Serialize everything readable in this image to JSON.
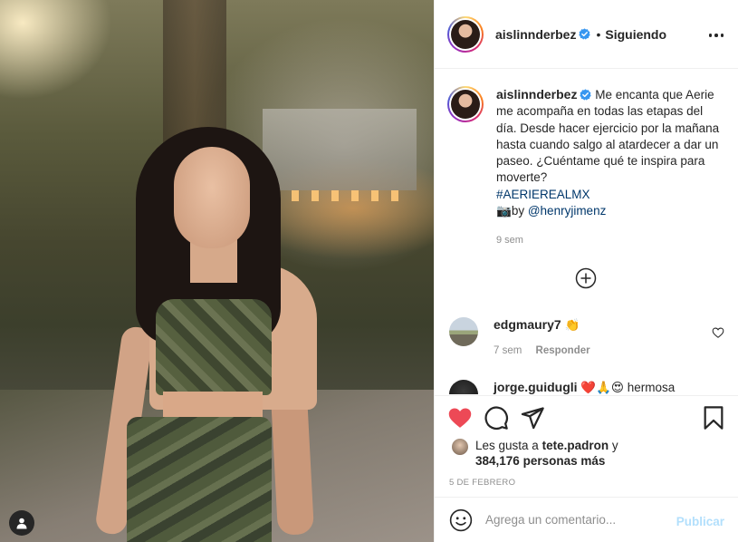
{
  "post": {
    "author": "aislinnderbez",
    "follow_status": "Siguiendo",
    "separator": "•",
    "caption": {
      "text": "Me encanta que Aerie me acompaña en todas las etapas del día. Desde hacer ejercicio por la mañana hasta cuando salgo al atardecer a dar un paseo. ¿Cuéntame qué te inspira para moverte?",
      "hashtag": "#AERIEREALMX",
      "credit_emoji": "📷",
      "credit_prefix": "by",
      "credit_mention": "@henryjimenz",
      "age": "9 sem"
    },
    "load_more_icon": "plus-circle-icon"
  },
  "comments": [
    {
      "user": "edgmaury7",
      "text": "👏",
      "age": "7 sem",
      "reply_label": "Responder"
    },
    {
      "user": "jorge.guidugli",
      "text": "❤️🙏😍 hermosa",
      "age": "",
      "reply_label": ""
    }
  ],
  "likes": {
    "prefix": "Les gusta a",
    "user": "tete.padron",
    "conjunction": "y",
    "count": "384,176",
    "suffix": "personas más"
  },
  "date": "5 DE FEBRERO",
  "add_comment": {
    "placeholder": "Agrega un comentario...",
    "publish_label": "Publicar"
  },
  "icons": {
    "like": "heart-filled-icon",
    "comment": "comment-icon",
    "share": "paper-plane-icon",
    "save": "bookmark-icon",
    "more": "more-dots-icon",
    "verified": "verified-badge-icon",
    "emoji": "smiley-icon",
    "user_tags": "user-tag-icon"
  },
  "colors": {
    "like": "#ed4956",
    "verified": "#3897f0",
    "link": "#00376b",
    "publish_disabled": "#b2dffc",
    "secondary_text": "#8e8e8e"
  }
}
